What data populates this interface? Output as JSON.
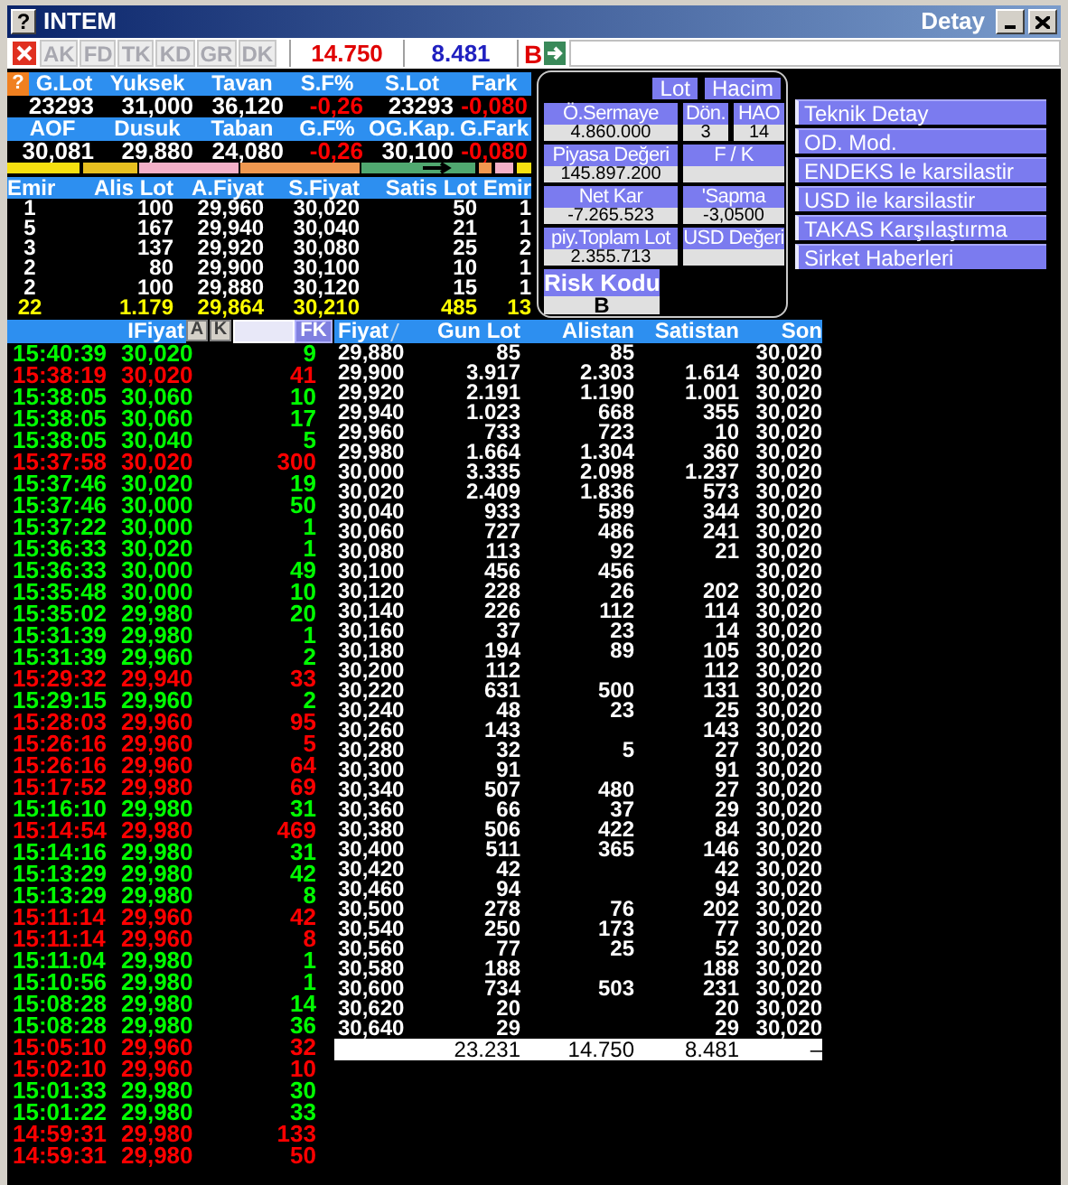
{
  "window": {
    "help_glyph": "?",
    "title": "INTEM",
    "side_title": "Detay"
  },
  "toolbar": {
    "buttons": [
      "AK",
      "FD",
      "TK",
      "KD",
      "GR",
      "DK"
    ],
    "buy_total": "14.750",
    "sell_total": "8.481",
    "flag": "B"
  },
  "summary": {
    "help_glyph": "?",
    "blocks": [
      {
        "headers": [
          "G.Lot",
          "Yuksek",
          "Tavan",
          "S.F%",
          "S.Lot",
          "Fark"
        ],
        "values": [
          {
            "text": "23293",
            "negative": false
          },
          {
            "text": "31,000",
            "negative": false
          },
          {
            "text": "36,120",
            "negative": false
          },
          {
            "text": "-0,26",
            "negative": true
          },
          {
            "text": "23293",
            "negative": false
          },
          {
            "text": "-0,080",
            "negative": true
          }
        ]
      },
      {
        "headers": [
          "AOF",
          "Dusuk",
          "Taban",
          "G.F%",
          "OG.Kap.",
          "G.Fark"
        ],
        "values": [
          {
            "text": "30,081",
            "negative": false
          },
          {
            "text": "29,880",
            "negative": false
          },
          {
            "text": "24,080",
            "negative": false
          },
          {
            "text": "-0,26",
            "negative": true
          },
          {
            "text": "30,100",
            "negative": false
          },
          {
            "text": "-0,080",
            "negative": true
          }
        ]
      }
    ]
  },
  "depth": {
    "columns": [
      "Emir",
      "Alis Lot",
      "A.Fiyat",
      "S.Fiyat",
      "Satis Lot",
      "Emir"
    ],
    "rows": [
      [
        "1",
        "100",
        "29,960",
        "30,020",
        "50",
        "1"
      ],
      [
        "5",
        "167",
        "29,940",
        "30,040",
        "21",
        "1"
      ],
      [
        "3",
        "137",
        "29,920",
        "30,080",
        "25",
        "2"
      ],
      [
        "2",
        "80",
        "29,900",
        "30,100",
        "10",
        "1"
      ],
      [
        "2",
        "100",
        "29,880",
        "30,120",
        "15",
        "1"
      ]
    ],
    "totals": [
      "22",
      "1.179",
      "29,864",
      "30,210",
      "485",
      "13"
    ]
  },
  "info_panel": {
    "toggles": [
      "Lot",
      "Hacim"
    ],
    "rows": [
      [
        {
          "label": "Ö.Sermaye",
          "value": "4.860.000"
        },
        {
          "label": "Dön.",
          "value": "3"
        },
        {
          "label": "HAO",
          "value": "14"
        }
      ],
      [
        {
          "label": "Piyasa Değeri",
          "value": "145.897.200"
        },
        {
          "label": "F / K"
        }
      ],
      [
        {
          "label": "Net Kar",
          "value": "-7.265.523"
        },
        {
          "label": "'Sapma",
          "value": "-3,0500"
        }
      ],
      [
        {
          "label": "piy.Toplam Lot",
          "value": "2.355.713"
        },
        {
          "label": "USD Değeri"
        }
      ]
    ],
    "risk": {
      "label": "Risk Kodu",
      "value": "B"
    }
  },
  "links": [
    "Teknik Detay",
    "OD. Mod.",
    "ENDEKS le karsilastir",
    "USD ile karsilastir",
    "TAKAS Karşılaştırma",
    "Sirket Haberleri"
  ],
  "trades": {
    "header": "IFiyat",
    "buttons": [
      "A",
      "K"
    ],
    "filter_button": "FK",
    "rows": [
      {
        "time": "15:40:39",
        "price": "30,020",
        "lot": "9",
        "color": "#00ff00"
      },
      {
        "time": "15:38:19",
        "price": "30,020",
        "lot": "41",
        "color": "#ff0000"
      },
      {
        "time": "15:38:05",
        "price": "30,060",
        "lot": "10",
        "color": "#00ff00"
      },
      {
        "time": "15:38:05",
        "price": "30,060",
        "lot": "17",
        "color": "#00ff00"
      },
      {
        "time": "15:38:05",
        "price": "30,040",
        "lot": "5",
        "color": "#00ff00"
      },
      {
        "time": "15:37:58",
        "price": "30,020",
        "lot": "300",
        "color": "#ff0000"
      },
      {
        "time": "15:37:46",
        "price": "30,020",
        "lot": "19",
        "color": "#00ff00"
      },
      {
        "time": "15:37:46",
        "price": "30,000",
        "lot": "50",
        "color": "#00ff00"
      },
      {
        "time": "15:37:22",
        "price": "30,000",
        "lot": "1",
        "color": "#00ff00"
      },
      {
        "time": "15:36:33",
        "price": "30,020",
        "lot": "1",
        "color": "#00ff00"
      },
      {
        "time": "15:36:33",
        "price": "30,000",
        "lot": "49",
        "color": "#00ff00"
      },
      {
        "time": "15:35:48",
        "price": "30,000",
        "lot": "10",
        "color": "#00ff00"
      },
      {
        "time": "15:35:02",
        "price": "29,980",
        "lot": "20",
        "color": "#00ff00"
      },
      {
        "time": "15:31:39",
        "price": "29,980",
        "lot": "1",
        "color": "#00ff00"
      },
      {
        "time": "15:31:39",
        "price": "29,960",
        "lot": "2",
        "color": "#00ff00"
      },
      {
        "time": "15:29:32",
        "price": "29,940",
        "lot": "33",
        "color": "#ff0000"
      },
      {
        "time": "15:29:15",
        "price": "29,960",
        "lot": "2",
        "color": "#00ff00"
      },
      {
        "time": "15:28:03",
        "price": "29,960",
        "lot": "95",
        "color": "#ff0000"
      },
      {
        "time": "15:26:16",
        "price": "29,960",
        "lot": "5",
        "color": "#ff0000"
      },
      {
        "time": "15:26:16",
        "price": "29,960",
        "lot": "64",
        "color": "#ff0000"
      },
      {
        "time": "15:17:52",
        "price": "29,980",
        "lot": "69",
        "color": "#ff0000"
      },
      {
        "time": "15:16:10",
        "price": "29,980",
        "lot": "31",
        "color": "#00ff00"
      },
      {
        "time": "15:14:54",
        "price": "29,980",
        "lot": "469",
        "color": "#ff0000"
      },
      {
        "time": "15:14:16",
        "price": "29,980",
        "lot": "31",
        "color": "#00ff00"
      },
      {
        "time": "15:13:29",
        "price": "29,980",
        "lot": "42",
        "color": "#00ff00"
      },
      {
        "time": "15:13:29",
        "price": "29,980",
        "lot": "8",
        "color": "#00ff00"
      },
      {
        "time": "15:11:14",
        "price": "29,960",
        "lot": "42",
        "color": "#ff0000"
      },
      {
        "time": "15:11:14",
        "price": "29,960",
        "lot": "8",
        "color": "#ff0000"
      },
      {
        "time": "15:11:04",
        "price": "29,980",
        "lot": "1",
        "color": "#00ff00"
      },
      {
        "time": "15:10:56",
        "price": "29,980",
        "lot": "1",
        "color": "#00ff00"
      },
      {
        "time": "15:08:28",
        "price": "29,980",
        "lot": "14",
        "color": "#00ff00"
      },
      {
        "time": "15:08:28",
        "price": "29,980",
        "lot": "36",
        "color": "#00ff00"
      },
      {
        "time": "15:05:10",
        "price": "29,960",
        "lot": "32",
        "color": "#ff0000"
      },
      {
        "time": "15:02:10",
        "price": "29,960",
        "lot": "10",
        "color": "#ff0000"
      },
      {
        "time": "15:01:33",
        "price": "29,980",
        "lot": "30",
        "color": "#00ff00"
      },
      {
        "time": "15:01:22",
        "price": "29,980",
        "lot": "33",
        "color": "#00ff00"
      },
      {
        "time": "14:59:31",
        "price": "29,980",
        "lot": "133",
        "color": "#ff0000"
      },
      {
        "time": "14:59:31",
        "price": "29,980",
        "lot": "50",
        "color": "#ff0000"
      }
    ]
  },
  "price_table": {
    "columns": [
      "Fiyat",
      "Gun Lot",
      "Alistan",
      "Satistan",
      "Son"
    ],
    "rows": [
      {
        "price": "29,880",
        "gun_lot": "85",
        "alistan": "85",
        "son": "30,020"
      },
      {
        "price": "29,900",
        "gun_lot": "3.917",
        "alistan": "2.303",
        "satistan": "1.614",
        "son": "30,020"
      },
      {
        "price": "29,920",
        "gun_lot": "2.191",
        "alistan": "1.190",
        "satistan": "1.001",
        "son": "30,020"
      },
      {
        "price": "29,940",
        "gun_lot": "1.023",
        "alistan": "668",
        "satistan": "355",
        "son": "30,020"
      },
      {
        "price": "29,960",
        "gun_lot": "733",
        "alistan": "723",
        "satistan": "10",
        "son": "30,020"
      },
      {
        "price": "29,980",
        "gun_lot": "1.664",
        "alistan": "1.304",
        "satistan": "360",
        "son": "30,020"
      },
      {
        "price": "30,000",
        "gun_lot": "3.335",
        "alistan": "2.098",
        "satistan": "1.237",
        "son": "30,020"
      },
      {
        "price": "30,020",
        "gun_lot": "2.409",
        "alistan": "1.836",
        "satistan": "573",
        "son": "30,020"
      },
      {
        "price": "30,040",
        "gun_lot": "933",
        "alistan": "589",
        "satistan": "344",
        "son": "30,020"
      },
      {
        "price": "30,060",
        "gun_lot": "727",
        "alistan": "486",
        "satistan": "241",
        "son": "30,020"
      },
      {
        "price": "30,080",
        "gun_lot": "113",
        "alistan": "92",
        "satistan": "21",
        "son": "30,020"
      },
      {
        "price": "30,100",
        "gun_lot": "456",
        "alistan": "456",
        "son": "30,020"
      },
      {
        "price": "30,120",
        "gun_lot": "228",
        "alistan": "26",
        "satistan": "202",
        "son": "30,020"
      },
      {
        "price": "30,140",
        "gun_lot": "226",
        "alistan": "112",
        "satistan": "114",
        "son": "30,020"
      },
      {
        "price": "30,160",
        "gun_lot": "37",
        "alistan": "23",
        "satistan": "14",
        "son": "30,020"
      },
      {
        "price": "30,180",
        "gun_lot": "194",
        "alistan": "89",
        "satistan": "105",
        "son": "30,020"
      },
      {
        "price": "30,200",
        "gun_lot": "112",
        "satistan": "112",
        "son": "30,020"
      },
      {
        "price": "30,220",
        "gun_lot": "631",
        "alistan": "500",
        "satistan": "131",
        "son": "30,020"
      },
      {
        "price": "30,240",
        "gun_lot": "48",
        "alistan": "23",
        "satistan": "25",
        "son": "30,020"
      },
      {
        "price": "30,260",
        "gun_lot": "143",
        "satistan": "143",
        "son": "30,020"
      },
      {
        "price": "30,280",
        "gun_lot": "32",
        "alistan": "5",
        "satistan": "27",
        "son": "30,020"
      },
      {
        "price": "30,300",
        "gun_lot": "91",
        "satistan": "91",
        "son": "30,020"
      },
      {
        "price": "30,340",
        "gun_lot": "507",
        "alistan": "480",
        "satistan": "27",
        "son": "30,020"
      },
      {
        "price": "30,360",
        "gun_lot": "66",
        "alistan": "37",
        "satistan": "29",
        "son": "30,020"
      },
      {
        "price": "30,380",
        "gun_lot": "506",
        "alistan": "422",
        "satistan": "84",
        "son": "30,020"
      },
      {
        "price": "30,400",
        "gun_lot": "511",
        "alistan": "365",
        "satistan": "146",
        "son": "30,020"
      },
      {
        "price": "30,420",
        "gun_lot": "42",
        "satistan": "42",
        "son": "30,020"
      },
      {
        "price": "30,460",
        "gun_lot": "94",
        "satistan": "94",
        "son": "30,020"
      },
      {
        "price": "30,500",
        "gun_lot": "278",
        "alistan": "76",
        "satistan": "202",
        "son": "30,020"
      },
      {
        "price": "30,540",
        "gun_lot": "250",
        "alistan": "173",
        "satistan": "77",
        "son": "30,020"
      },
      {
        "price": "30,560",
        "gun_lot": "77",
        "alistan": "25",
        "satistan": "52",
        "son": "30,020"
      },
      {
        "price": "30,580",
        "gun_lot": "188",
        "satistan": "188",
        "son": "30,020"
      },
      {
        "price": "30,600",
        "gun_lot": "734",
        "alistan": "503",
        "satistan": "231",
        "son": "30,020"
      },
      {
        "price": "30,620",
        "gun_lot": "20",
        "satistan": "20",
        "son": "30,020"
      },
      {
        "price": "30,640",
        "gun_lot": "29",
        "satistan": "29",
        "son": "30,020"
      }
    ],
    "totals": {
      "gun_lot": "23.231",
      "alistan": "14.750",
      "satistan": "8.481",
      "son": "–"
    }
  }
}
